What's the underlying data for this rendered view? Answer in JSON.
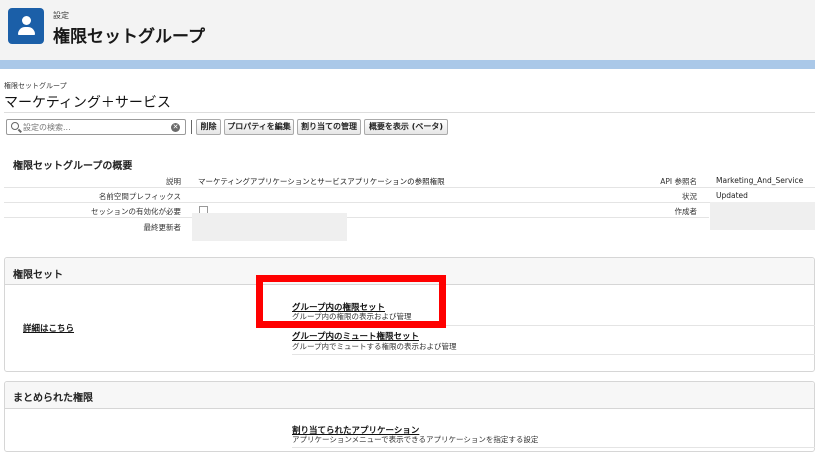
{
  "header": {
    "eyebrow": "設定",
    "title": "権限セットグループ"
  },
  "record": {
    "breadcrumb": "権限セットグループ",
    "name": "マーケティング＋サービス"
  },
  "toolbar": {
    "search_placeholder": "設定の検索...",
    "buttons": [
      "削除",
      "プロパティを編集",
      "割り当ての管理",
      "概要を表示 (ベータ)"
    ]
  },
  "overview": {
    "title": "権限セットグループの概要",
    "description_label": "説明",
    "description_value": "マーケティングアプリケーションとサービスアプリケーションの参照権限",
    "namespace_label": "名前空間プレフィックス",
    "session_label": "セッションの有効化が必要",
    "modified_label": "最終更新者",
    "api_label": "API 参照名",
    "api_value": "Marketing_And_Service",
    "status_label": "状況",
    "status_value": "Updated",
    "created_label": "作成者"
  },
  "permission_sets": {
    "title": "権限セット",
    "detail_link": "詳細はこちら",
    "items": [
      {
        "link": "グループ内の権限セット",
        "desc": "グループ内の権限の表示および管理"
      },
      {
        "link": "グループ内のミュート権限セット",
        "desc": "グループ内でミュートする権限の表示および管理"
      }
    ]
  },
  "combined": {
    "title": "まとめられた権限",
    "items": [
      {
        "link": "割り当てられたアプリケーション",
        "desc": "アプリケーションメニューで表示できるアプリケーションを指定する設定"
      }
    ]
  },
  "colors": {
    "brand": "#1b5fa8",
    "highlight": "#ff0000",
    "band": "#aac8e8"
  }
}
